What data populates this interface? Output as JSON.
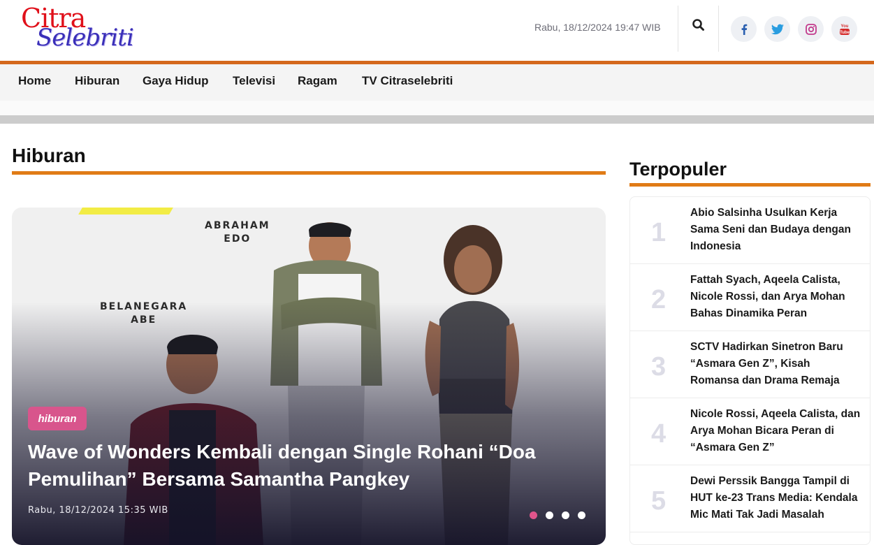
{
  "header": {
    "logo_line1": "Citra",
    "logo_line2": "Selebriti",
    "date": "Rabu, 18/12/2024 19:47 WIB",
    "social": [
      "facebook-icon",
      "twitter-icon",
      "instagram-icon",
      "youtube-icon"
    ],
    "social_color": "#2a8fd6"
  },
  "nav": {
    "items": [
      "Home",
      "Hiburan",
      "Gaya Hidup",
      "Televisi",
      "Ragam",
      "TV Citraselebriti"
    ],
    "accent": "#d4681c"
  },
  "main": {
    "section_title": "Hiburan",
    "hero": {
      "tag": "hiburan",
      "title": "Wave of Wonders Kembali dengan Single Rohani “Doa Pemulihan” Bersama Samantha Pangkey",
      "date": "Rabu, 18/12/2024 15:35 WIB",
      "labels": [
        "ABRAHAM\nEDO",
        "BELANEGARA\nABE"
      ],
      "slides": 4,
      "active_slide": 1
    }
  },
  "sidebar": {
    "title": "Terpopuler",
    "items": [
      {
        "num": "1",
        "text": "Abio Salsinha Usulkan Kerja Sama Seni dan Budaya dengan Indonesia"
      },
      {
        "num": "2",
        "text": "Fattah Syach, Aqeela Calista, Nicole Rossi, dan Arya Mohan Bahas Dinamika Peran"
      },
      {
        "num": "3",
        "text": "SCTV Hadirkan Sinetron Baru “Asmara Gen Z”, Kisah Romansa dan Drama Remaja"
      },
      {
        "num": "4",
        "text": "Nicole Rossi, Aqeela Calista, dan Arya Mohan Bicara Peran di “Asmara Gen Z”"
      },
      {
        "num": "5",
        "text": "Dewi Perssik Bangga Tampil di HUT ke-23 Trans Media: Kendala Mic Mati Tak Jadi Masalah"
      }
    ]
  }
}
